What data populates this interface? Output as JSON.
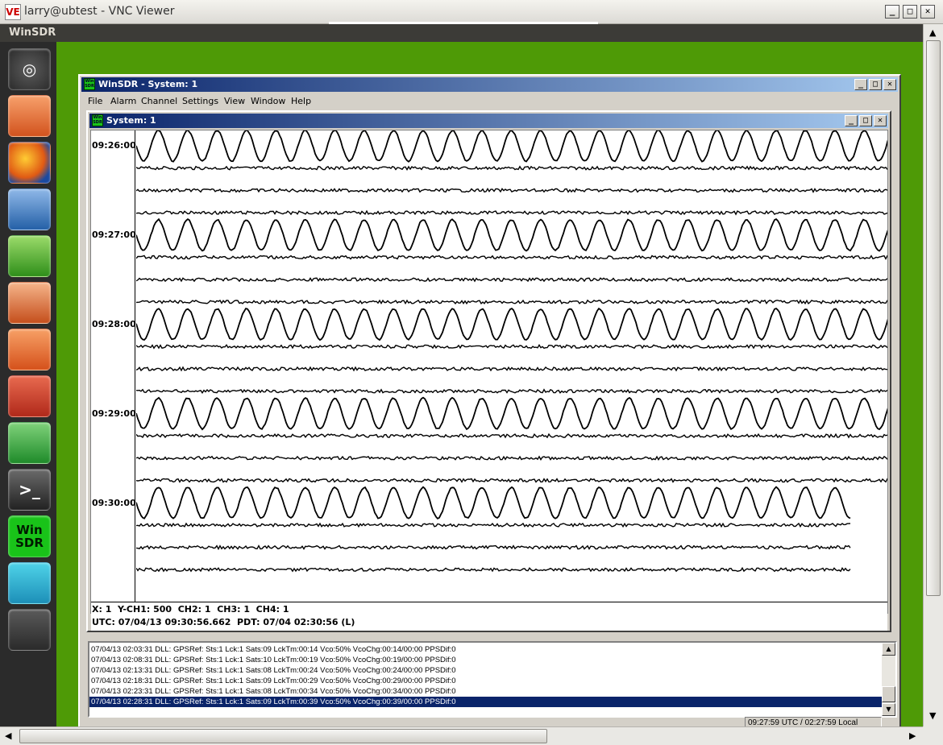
{
  "vnc": {
    "logo": "VE",
    "title": "larry@ubtest - VNC Viewer",
    "min": "_",
    "max": "□",
    "close": "✕"
  },
  "desktop": {
    "panel_title": "WinSDR",
    "launcher": [
      {
        "name": "ubuntu-dash-icon",
        "glyph": "◎"
      },
      {
        "name": "files-folder-icon",
        "glyph": ""
      },
      {
        "name": "firefox-icon",
        "glyph": ""
      },
      {
        "name": "writer-document-icon",
        "glyph": ""
      },
      {
        "name": "calc-spreadsheet-icon",
        "glyph": ""
      },
      {
        "name": "impress-presentation-icon",
        "glyph": ""
      },
      {
        "name": "software-center-bag-icon",
        "glyph": ""
      },
      {
        "name": "system-settings-icon",
        "glyph": ""
      },
      {
        "name": "wine-config-icon",
        "glyph": ""
      },
      {
        "name": "terminal-icon",
        "glyph": ">_"
      },
      {
        "name": "winsdr-app-icon",
        "glyph": "Win SDR"
      },
      {
        "name": "seismogram-app-icon",
        "glyph": ""
      },
      {
        "name": "workspace-switcher-icon",
        "glyph": ""
      }
    ]
  },
  "winsdr": {
    "icon_text": "Win SDR",
    "title": "WinSDR - System: 1",
    "menu": [
      "File",
      "Alarm",
      "Channel",
      "Settings",
      "View",
      "Window",
      "Help"
    ],
    "system_title": "System: 1",
    "time_labels": [
      "09:26:00",
      "09:27:00",
      "09:28:00",
      "09:29:00",
      "09:30:00"
    ],
    "status_line1": "X: 1  Y-CH1: 500  CH2: 1  CH3: 1  CH4: 1",
    "status_line2": "UTC: 07/04/13 09:30:56.662  PDT: 07/04 02:30:56 (L)",
    "log": [
      "07/04/13 02:03:31 DLL: GPSRef: Sts:1 Lck:1 Sats:09 LckTm:00:14 Vco:50% VcoChg:00:14/00:00 PPSDif:0",
      "07/04/13 02:08:31 DLL: GPSRef: Sts:1 Lck:1 Sats:10 LckTm:00:19 Vco:50% VcoChg:00:19/00:00 PPSDif:0",
      "07/04/13 02:13:31 DLL: GPSRef: Sts:1 Lck:1 Sats:08 LckTm:00:24 Vco:50% VcoChg:00:24/00:00 PPSDif:0",
      "07/04/13 02:18:31 DLL: GPSRef: Sts:1 Lck:1 Sats:09 LckTm:00:29 Vco:50% VcoChg:00:29/00:00 PPSDif:0",
      "07/04/13 02:23:31 DLL: GPSRef: Sts:1 Lck:1 Sats:08 LckTm:00:34 Vco:50% VcoChg:00:34/00:00 PPSDif:0",
      "07/04/13 02:28:31 DLL: GPSRef: Sts:1 Lck:1 Sats:09 LckTm:00:39 Vco:50% VcoChg:00:39/00:00 PPSDif:0"
    ],
    "selected_log_index": 5,
    "clock": "09:27:59 UTC / 02:27:59 Local"
  }
}
